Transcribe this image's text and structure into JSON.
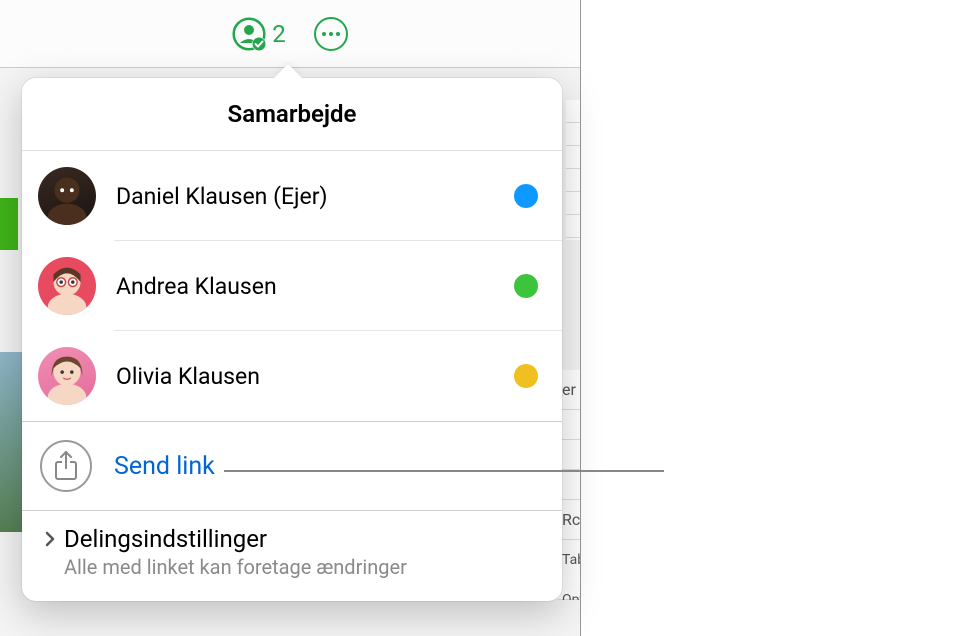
{
  "toolbar": {
    "collaborator_count": "2"
  },
  "popover": {
    "title": "Samarbejde",
    "participants": [
      {
        "name": "Daniel Klausen (Ejer)",
        "status_color": "#0d99ff"
      },
      {
        "name": "Andrea Klausen",
        "status_color": "#3cc43c"
      },
      {
        "name": "Olivia Klausen",
        "status_color": "#f0c020"
      }
    ],
    "send_link_label": "Send link",
    "settings": {
      "title": "Delingsindstillinger",
      "subtitle": "Alle med linket kan foretage ændringer"
    }
  },
  "background": {
    "right_panel_fragments": [
      "er",
      "Rc",
      "Table Options"
    ]
  },
  "colors": {
    "accent_green": "#22a74d",
    "link_blue": "#0066d6"
  }
}
